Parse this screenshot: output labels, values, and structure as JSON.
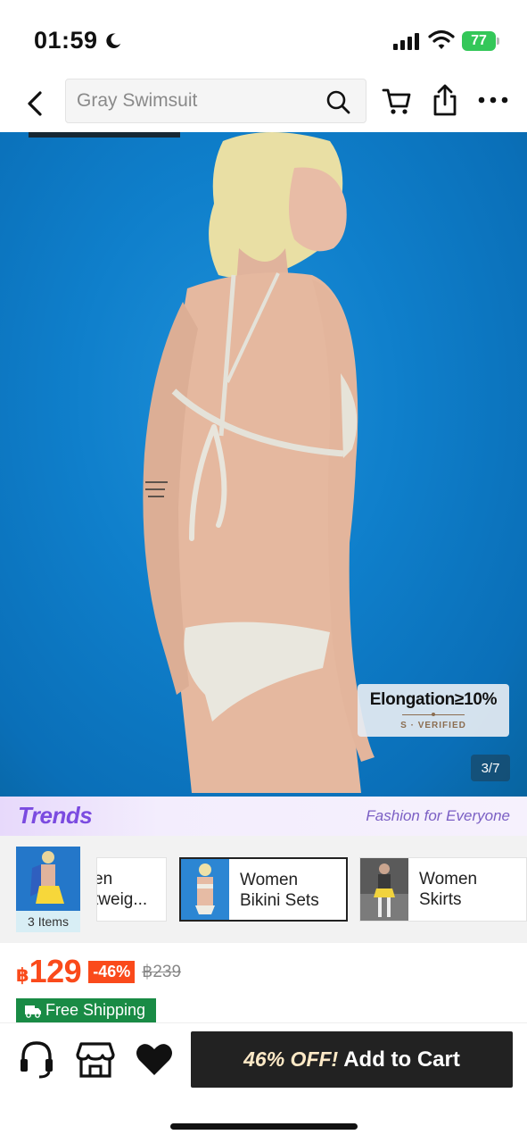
{
  "status_bar": {
    "time": "01:59",
    "battery": "77"
  },
  "search": {
    "placeholder": "Gray Swimsuit"
  },
  "product": {
    "badge_main": "Elongation≥10%",
    "badge_sub": "S · VERIFIED",
    "image_counter": "3/7"
  },
  "trends": {
    "logo": "Trends",
    "tagline": "Fashion for Everyone",
    "items_count": "3 Items",
    "cards": [
      {
        "label": "en\ntweig..."
      },
      {
        "label": "Women\nBikini Sets"
      },
      {
        "label": "Women\nSkirts"
      }
    ]
  },
  "price": {
    "currency": "฿",
    "current": "129",
    "discount": "-46%",
    "original": "฿239"
  },
  "shipping": {
    "label": "Free Shipping"
  },
  "cta": {
    "promo": "46% OFF!",
    "label": "Add to Cart"
  },
  "colors": {
    "accent": "#fa4a1b",
    "shipping": "#198b45",
    "cta_bg": "#222222",
    "trends": "#7b4be0"
  }
}
